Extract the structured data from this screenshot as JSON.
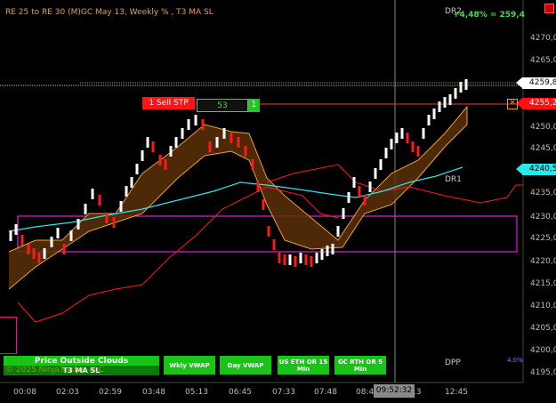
{
  "header": {
    "title": "RE 25 to RE 30 (M)GC May 13, Weekly % , T3 MA SL",
    "profit": "+4,48% = 259,4",
    "dr2": "DR2",
    "dr1": "DR1",
    "dpp": "DPP",
    "dpp_pct": "4.0%"
  },
  "price_axis": {
    "ticks": [
      "4270,0",
      "4265,0",
      "4255,0",
      "4250,0",
      "4245,0",
      "4235,0",
      "4230,0",
      "4225,0",
      "4220,0",
      "4215,0",
      "4210,0",
      "4205,0",
      "4200,0",
      "4195,0"
    ],
    "last_price": "4259,8",
    "stop_price": "4255,2",
    "t3_price": "4240,5"
  },
  "time_axis": {
    "ticks": [
      "00:08",
      "02:03",
      "02:59",
      "03:48",
      "05:13",
      "06:45",
      "07:33",
      "07:48",
      "08:4",
      "13",
      "12:45"
    ],
    "cursor_time": "09:52:32"
  },
  "order": {
    "sell_label": "1  Sell STP",
    "quantity": "53",
    "plus_label": "1",
    "close_label": "✕"
  },
  "buttons": {
    "price_outside_clouds": "Price Outside Clouds",
    "t3_ma_sl": "T3 MA SL",
    "wkly_vwap": "Wkly VWAP",
    "day_vwap": "Day VWAP",
    "us_eth": "US ETH OR 15 Min",
    "gc_rth": "GC RTH OR 5 Min"
  },
  "copyright": "© 2025 NinjaTrader, LLC",
  "colors": {
    "up_bar": "#ffffff",
    "down_bar": "#ff1a1a",
    "cloud": "#5a3008",
    "cloud_edge": "#f0a030",
    "t3_line": "#2de6e6",
    "stop_line": "#ff1a1a",
    "box": "#e020e0",
    "button_green": "#18c418"
  }
}
